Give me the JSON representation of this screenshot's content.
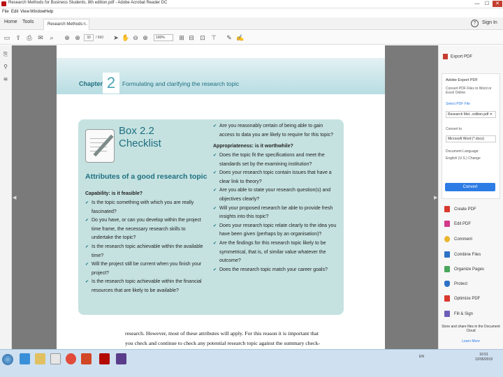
{
  "window": {
    "title": "Research Methods for Business Students, 8th edition.pdf - Adobe Acrobat Reader DC",
    "controls": [
      "—",
      "☐",
      "✕"
    ]
  },
  "menu": [
    "File",
    "Edit",
    "View",
    "Window",
    "Help"
  ],
  "tabs": {
    "home": "Home",
    "tools": "Tools",
    "document": "Research Methods ..."
  },
  "account": {
    "help": "?",
    "signin": "Sign In"
  },
  "toolbar": {
    "page_current": "33",
    "page_total": "/ 660",
    "zoom": "100%"
  },
  "page": {
    "chapter_label": "Chapter",
    "chapter_number": "2",
    "chapter_title": "Formulating and clarifying the research topic",
    "box_number": "Box 2.2",
    "box_title": "Checklist",
    "attributes_heading": "Attributes of a good research topic",
    "capability_heading": "Capability: is it feasible?",
    "capability_items": [
      "Is the topic something with which you are really fascinated?",
      "Do you have, or can you develop within the project time frame, the necessary research skills to undertake the topic?",
      "Is the research topic achievable within the available time?",
      "Will the project still be current when you finish your project?",
      "Is the research topic achievable within the financial resources that are likely to be available?"
    ],
    "right_top_item": "Are you reasonably certain of being able to gain access to data you are likely to require for this topic?",
    "appropriateness_heading": "Appropriateness: is it worthwhile?",
    "appropriateness_items": [
      "Does the topic fit the specifications and meet the standards set by the examining institution?",
      "Does your research topic contain issues that have a clear link to theory?",
      "Are you able to state your research question(s) and objectives clearly?",
      "Will your proposed research be able to provide fresh insights into this topic?",
      "Does your research topic relate clearly to the idea you have been given (perhaps by an organisation)?",
      "Are the findings for this research topic likely to be symmetrical, that is, of similar value whatever the outcome?",
      "Does the research topic match your career goals?"
    ],
    "body_line1": "research. However, most of these attributes will apply. For this reason it is important that",
    "body_line2": "you check and continue to check any potential research topic against the summary check-"
  },
  "right_panel": {
    "export_heading": "Export PDF",
    "card_title": "Adobe Export PDF",
    "card_desc": "Convert PDF Files to Word or Excel Online",
    "select_label": "Select PDF File",
    "file_value": "Research Met...edition.pdf ✕",
    "convert_label": "Convert to",
    "format_value": "Microsoft Word (*.docx)",
    "language_label": "Document Language:",
    "language_value": "English (U.S.)  Change",
    "convert_button": "Convert",
    "tools": [
      {
        "label": "Create PDF",
        "color": "#d9392e"
      },
      {
        "label": "Edit PDF",
        "color": "#d23a8a"
      },
      {
        "label": "Comment",
        "color": "#e8b52c"
      },
      {
        "label": "Combine Files",
        "color": "#2e72c7"
      },
      {
        "label": "Organize Pages",
        "color": "#4aa65a"
      },
      {
        "label": "Protect",
        "color": "#2e72c7"
      },
      {
        "label": "Optimize PDF",
        "color": "#d9392e"
      },
      {
        "label": "Fill & Sign",
        "color": "#6c5fb8"
      }
    ],
    "footer": "Store and share files in the Document Cloud",
    "learn_more": "Learn More"
  },
  "taskbar": {
    "time": "16:51",
    "date": "12/05/2019",
    "tray": "EN"
  }
}
